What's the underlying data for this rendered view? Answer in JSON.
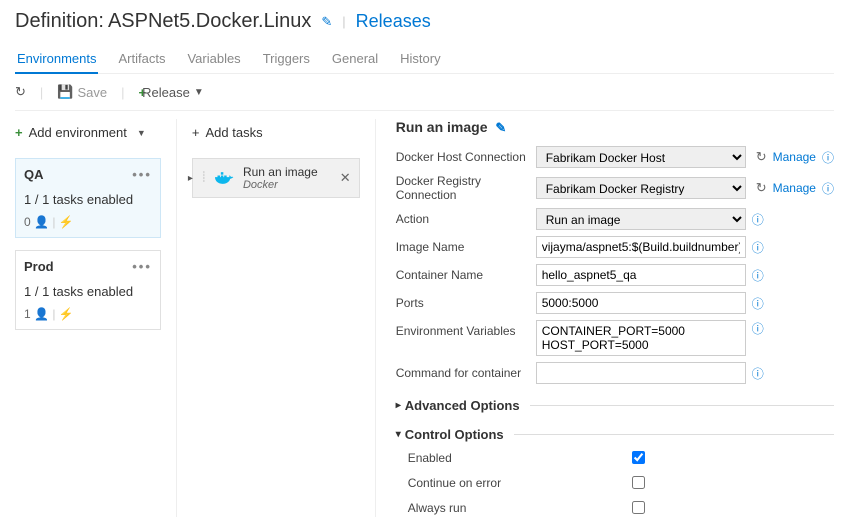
{
  "header": {
    "definition_prefix": "Definition:",
    "definition_name": "ASPNet5.Docker.Linux",
    "releases_link": "Releases"
  },
  "tabs": {
    "items": [
      "Environments",
      "Artifacts",
      "Variables",
      "Triggers",
      "General",
      "History"
    ],
    "active": 0
  },
  "toolbar": {
    "save_label": "Save",
    "release_label": "Release"
  },
  "sidebar": {
    "add_env": "Add environment",
    "envs": [
      {
        "name": "QA",
        "status": "1 / 1 tasks enabled",
        "count": "0"
      },
      {
        "name": "Prod",
        "status": "1 / 1 tasks enabled",
        "count": "1"
      }
    ]
  },
  "tasks": {
    "add_tasks": "Add tasks",
    "list": [
      {
        "title": "Run an image",
        "subtitle": "Docker"
      }
    ]
  },
  "pane": {
    "title": "Run an image",
    "manage": "Manage",
    "fields": {
      "docker_host_label": "Docker Host Connection",
      "docker_host_value": "Fabrikam Docker Host",
      "docker_reg_label": "Docker Registry Connection",
      "docker_reg_value": "Fabrikam Docker Registry",
      "action_label": "Action",
      "action_value": "Run an image",
      "image_label": "Image Name",
      "image_value": "vijayma/aspnet5:$(Build.buildnumber)",
      "container_label": "Container Name",
      "container_value": "hello_aspnet5_qa",
      "ports_label": "Ports",
      "ports_value": "5000:5000",
      "envvars_label": "Environment Variables",
      "envvars_value": "CONTAINER_PORT=5000\nHOST_PORT=5000",
      "command_label": "Command for container",
      "command_value": ""
    },
    "sections": {
      "advanced": "Advanced Options",
      "control": "Control Options"
    },
    "control": {
      "enabled_label": "Enabled",
      "enabled_checked": true,
      "continue_label": "Continue on error",
      "continue_checked": false,
      "always_label": "Always run",
      "always_checked": false
    }
  }
}
